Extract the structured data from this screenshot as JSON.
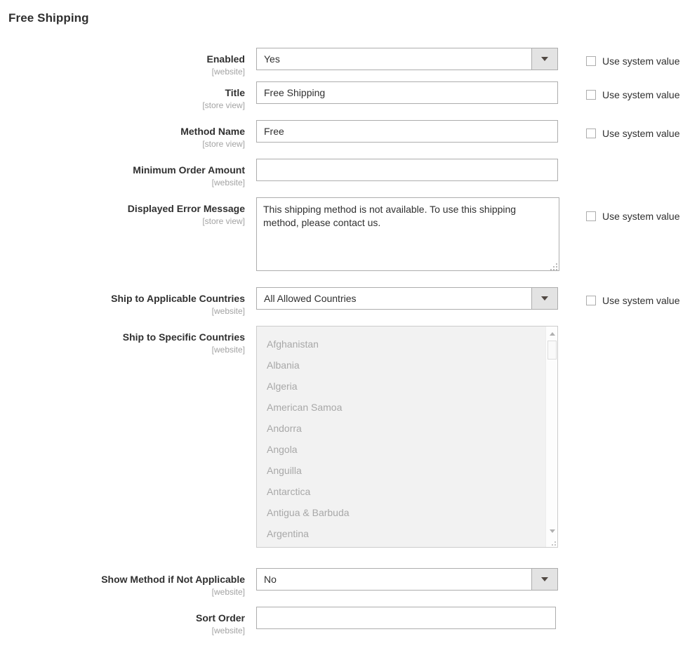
{
  "page": {
    "section_title": "Free Shipping"
  },
  "system_value_label": "Use system value",
  "colors": {
    "text": "#303030",
    "scope": "#a3a3a3",
    "border": "#adadad",
    "disabled_bg": "#f2f2f2",
    "disabled_text": "#a8a8a8",
    "dropdown_button_bg": "#e3e3e3"
  },
  "fields": {
    "enabled": {
      "label": "Enabled",
      "scope": "[website]",
      "type": "select",
      "value": "Yes",
      "use_system_value": true,
      "checked": false
    },
    "title": {
      "label": "Title",
      "scope": "[store view]",
      "type": "text",
      "value": "Free Shipping",
      "placeholder": "",
      "use_system_value": true,
      "checked": false
    },
    "method_name": {
      "label": "Method Name",
      "scope": "[store view]",
      "type": "text",
      "value": "Free",
      "placeholder": "",
      "use_system_value": true,
      "checked": false
    },
    "minimum_order_amount": {
      "label": "Minimum Order Amount",
      "scope": "[website]",
      "type": "text",
      "value": "",
      "placeholder": "",
      "use_system_value": false
    },
    "displayed_error_message": {
      "label": "Displayed Error Message",
      "scope": "[store view]",
      "type": "textarea",
      "value": "This shipping method is not available. To use this shipping method, please contact us.",
      "use_system_value": true,
      "checked": false
    },
    "ship_to_applicable_countries": {
      "label": "Ship to Applicable Countries",
      "scope": "[website]",
      "type": "select",
      "value": "All Allowed Countries",
      "use_system_value": true,
      "checked": false
    },
    "ship_to_specific_countries": {
      "label": "Ship to Specific Countries",
      "scope": "[website]",
      "type": "multiselect",
      "disabled": true,
      "options": [
        "Afghanistan",
        "Albania",
        "Algeria",
        "American Samoa",
        "Andorra",
        "Angola",
        "Anguilla",
        "Antarctica",
        "Antigua & Barbuda",
        "Argentina"
      ],
      "use_system_value": false
    },
    "show_method_if_not_applicable": {
      "label": "Show Method if Not Applicable",
      "scope": "[website]",
      "type": "select",
      "value": "No",
      "use_system_value": false
    },
    "sort_order": {
      "label": "Sort Order",
      "scope": "[website]",
      "type": "text",
      "value": "",
      "placeholder": "",
      "use_system_value": false
    }
  }
}
